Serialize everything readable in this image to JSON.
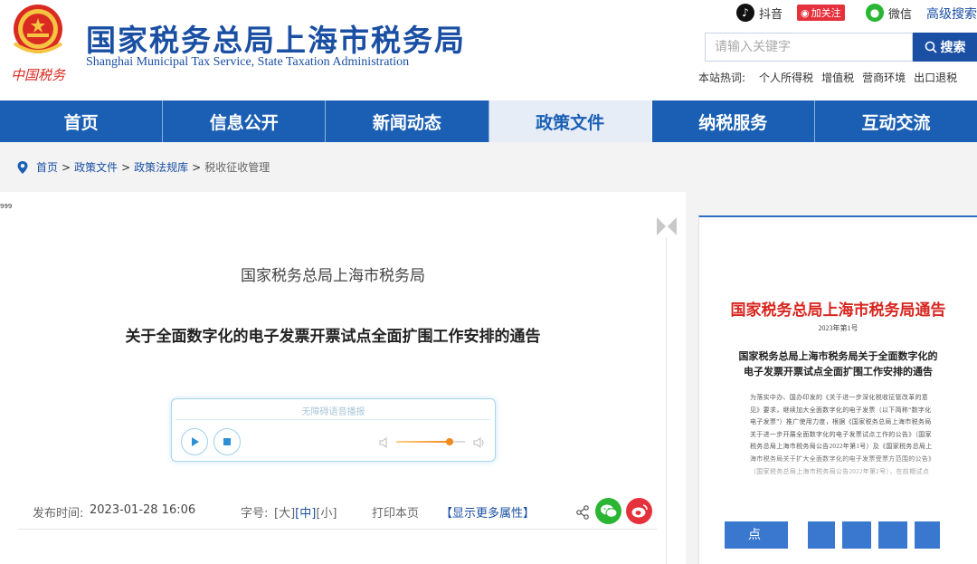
{
  "header": {
    "title": "国家税务总局上海市税务局",
    "subtitle": "Shanghai Municipal Tax Service, State Taxation Administration",
    "emblem_text": "中国税务"
  },
  "social": {
    "douyin": "抖音",
    "weibo_follow": "加关注",
    "wechat": "微信",
    "advanced_search": "高级搜索"
  },
  "search": {
    "placeholder": "请输入关键字",
    "button": "搜索"
  },
  "hot_words": {
    "label": "本站热词:",
    "items": [
      "个人所得税",
      "增值税",
      "营商环境",
      "出口退税"
    ]
  },
  "nav": {
    "items": [
      {
        "label": "首页"
      },
      {
        "label": "信息公开"
      },
      {
        "label": "新闻动态"
      },
      {
        "label": "政策文件",
        "active": true
      },
      {
        "label": "纳税服务"
      },
      {
        "label": "互动交流"
      }
    ]
  },
  "breadcrumb": {
    "items": [
      "首页",
      "政策文件",
      "政策法规库",
      "税收征收管理"
    ],
    "separator": ">"
  },
  "article": {
    "corner_mark": "999",
    "org": "国家税务总局上海市税务局",
    "title": "关于全面数字化的电子发票开票试点全面扩围工作安排的通告",
    "player_label": "无障碍语音播报",
    "volume_level": 0.78,
    "publish_label": "发布时间:",
    "publish_time": "2023-01-28 16:06",
    "font_size_label": "字号:",
    "font_sizes": [
      "[大]",
      "[中]",
      "[小]"
    ],
    "print": "打印本页",
    "more_attrs": "【显示更多属性】"
  },
  "side_doc": {
    "heading": "国家税务总局上海市税务局通告",
    "number": "2023年第1号",
    "title": "国家税务总局上海市税务局关于全面数字化的电子发票开票试点全面扩围工作安排的通告",
    "body": "为落实中办、国办印发的《关于进一步深化税收征管改革的意见》要求，继续加大全面数字化的电子发票（以下简称“数字化电子发票”）推广使用力度，根据《国家税务总局上海市税务局关于进一步开展全面数字化的电子发票试点工作的公告》（国家税务总局上海市税务局公告2022年第1号）及《国家税务总局上海市税务局关于扩大全面数字化的电子发票受票方范围的公告》（国家税务总局上海市税务局公告2022年第2号），在前期试点",
    "button": "点"
  },
  "colors": {
    "brand_blue": "#1a5fb4",
    "title_blue": "#1a4fa3",
    "red": "#d8261f"
  }
}
